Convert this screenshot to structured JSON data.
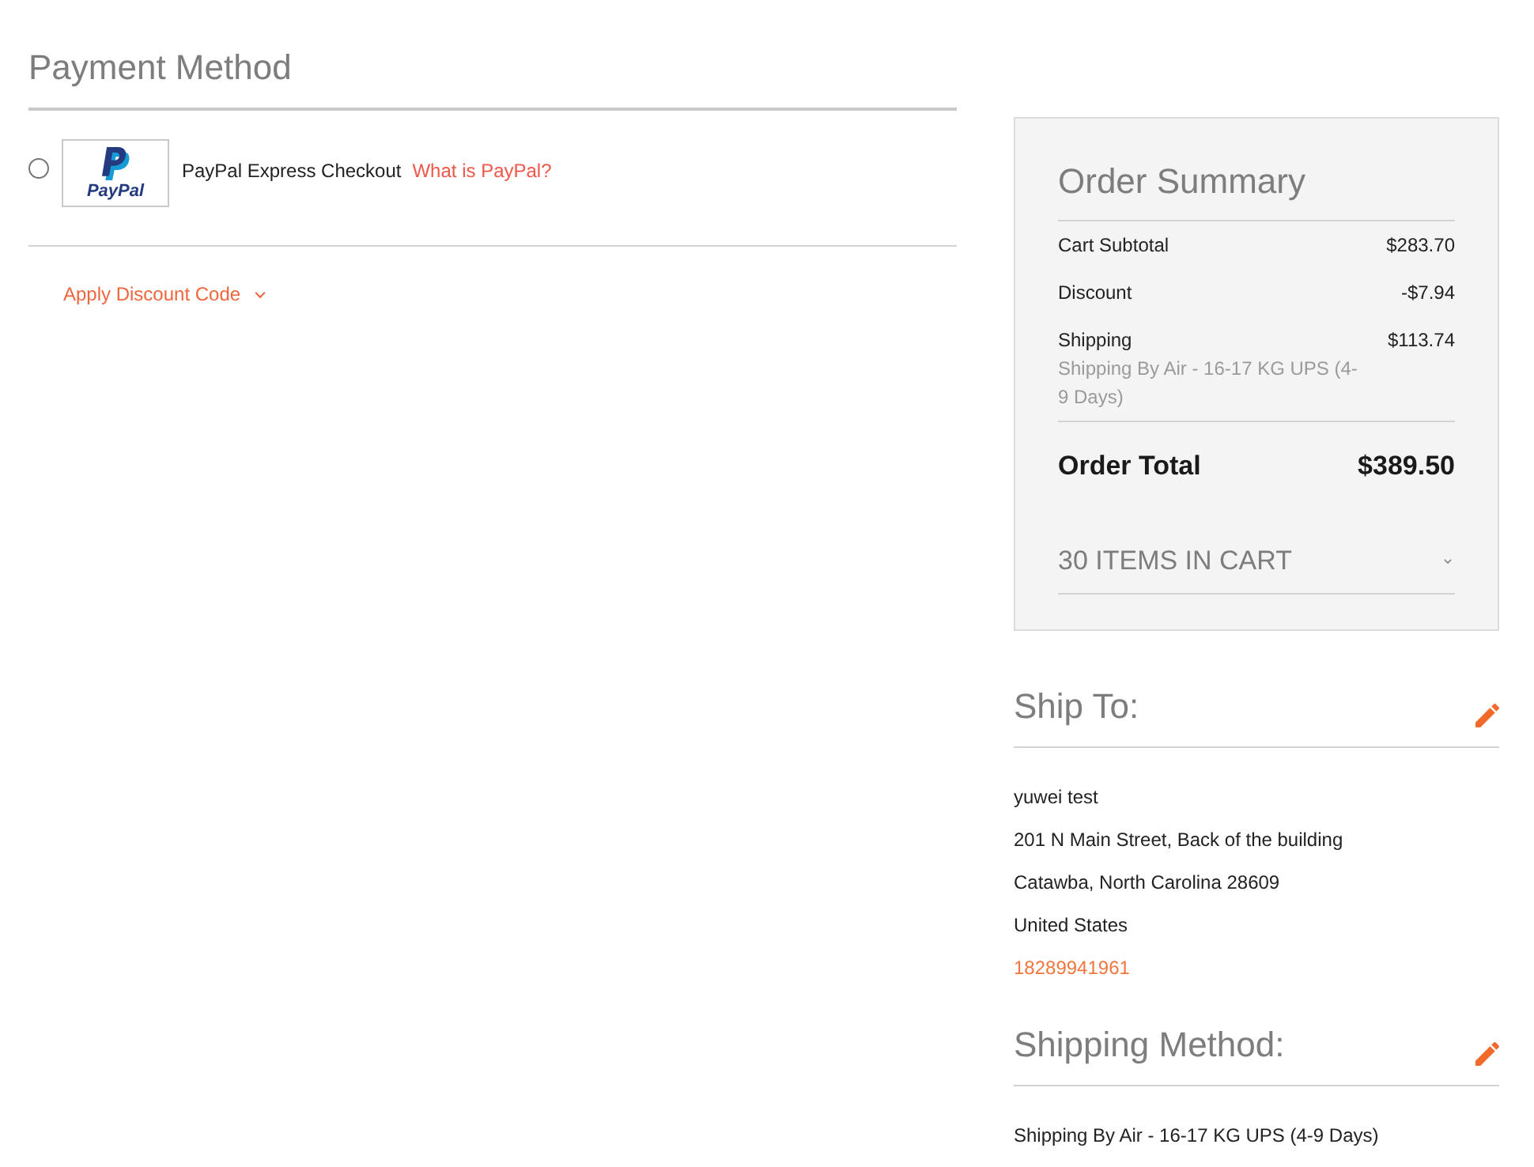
{
  "payment_method": {
    "title": "Payment Method",
    "options": [
      {
        "label": "PayPal Express Checkout",
        "logo_text": "PayPal",
        "link": "What is PayPal?",
        "selected": false
      }
    ]
  },
  "discount": {
    "label": "Apply Discount Code",
    "expanded": false
  },
  "order_summary": {
    "title": "Order Summary",
    "rows": [
      {
        "label": "Cart Subtotal",
        "value": "$283.70"
      },
      {
        "label": "Discount",
        "value": "-$7.94"
      },
      {
        "label": "Shipping",
        "value": "$113.74",
        "detail": "Shipping By Air - 16-17 KG UPS (4-9 Days)"
      }
    ],
    "total": {
      "label": "Order Total",
      "value": "$389.50"
    },
    "items_in_cart": {
      "label": "30 ITEMS IN CART",
      "expanded": false
    }
  },
  "ship_to": {
    "title": "Ship To:",
    "lines": [
      "yuwei test",
      "201 N Main Street, Back of the building",
      "Catawba, North Carolina 28609",
      "United States"
    ],
    "phone": "18289941961"
  },
  "shipping_method": {
    "title": "Shipping Method:",
    "text": "Shipping By Air - 16-17 KG UPS (4-9 Days)"
  }
}
